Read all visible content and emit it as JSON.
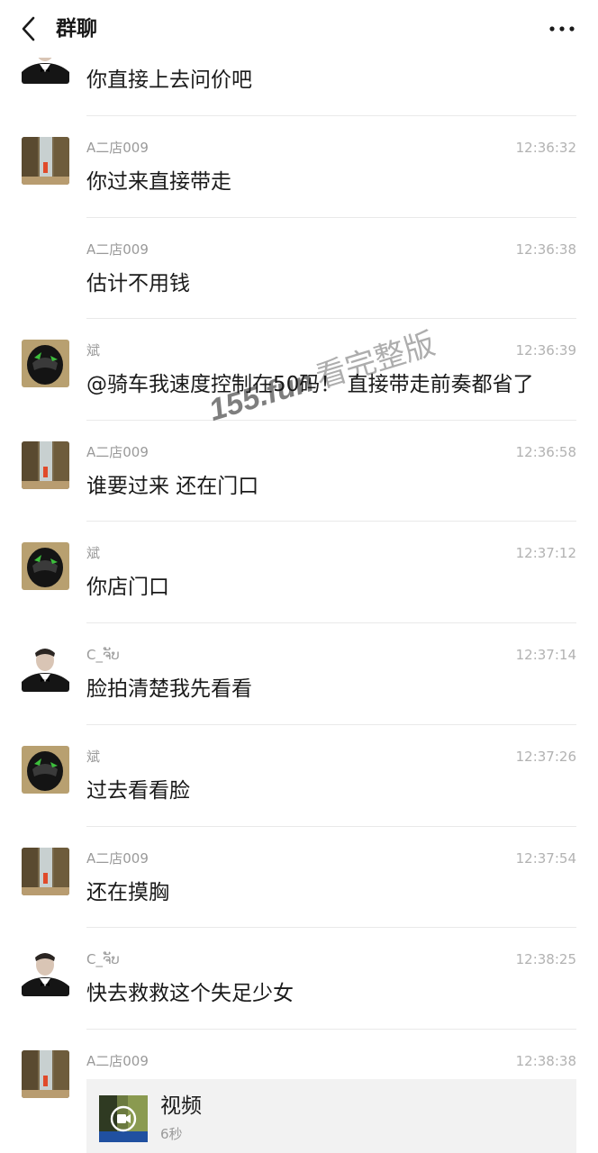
{
  "header": {
    "title": "群聊"
  },
  "messages": [
    {
      "sender": "",
      "time": "",
      "text": "你直接上去问价吧",
      "avatar": "tuxedo-man-avatar"
    },
    {
      "sender": "A二店009",
      "time": "12:36:32",
      "text": "你过来直接带走",
      "avatar": "waterfall-avatar"
    },
    {
      "sender": "A二店009",
      "time": "12:36:38",
      "text": "估计不用钱",
      "avatar": ""
    },
    {
      "sender": "斌",
      "time": "12:36:39",
      "text": "@骑车我速度控制在50码！ 直接带走前奏都省了",
      "avatar": "helmet-avatar"
    },
    {
      "sender": "A二店009",
      "time": "12:36:58",
      "text": "谁要过来 还在门口",
      "avatar": "waterfall-avatar"
    },
    {
      "sender": "斌",
      "time": "12:37:12",
      "text": "你店门口",
      "avatar": "helmet-avatar"
    },
    {
      "sender": "C_ຈັບ",
      "time": "12:37:14",
      "text": "脸拍清楚我先看看",
      "avatar": "tuxedo-man-avatar"
    },
    {
      "sender": "斌",
      "time": "12:37:26",
      "text": "过去看看脸",
      "avatar": "helmet-avatar"
    },
    {
      "sender": "A二店009",
      "time": "12:37:54",
      "text": "还在摸胸",
      "avatar": "waterfall-avatar"
    },
    {
      "sender": "C_ຈັບ",
      "time": "12:38:25",
      "text": "快去救救这个失足少女",
      "avatar": "tuxedo-man-avatar"
    },
    {
      "sender": "A二店009",
      "time": "12:38:38",
      "text": "",
      "avatar": "waterfall-avatar"
    }
  ],
  "video": {
    "title": "视频",
    "duration": "6秒"
  },
  "watermark": {
    "main": "155.fun",
    "sub": "看完整版"
  }
}
